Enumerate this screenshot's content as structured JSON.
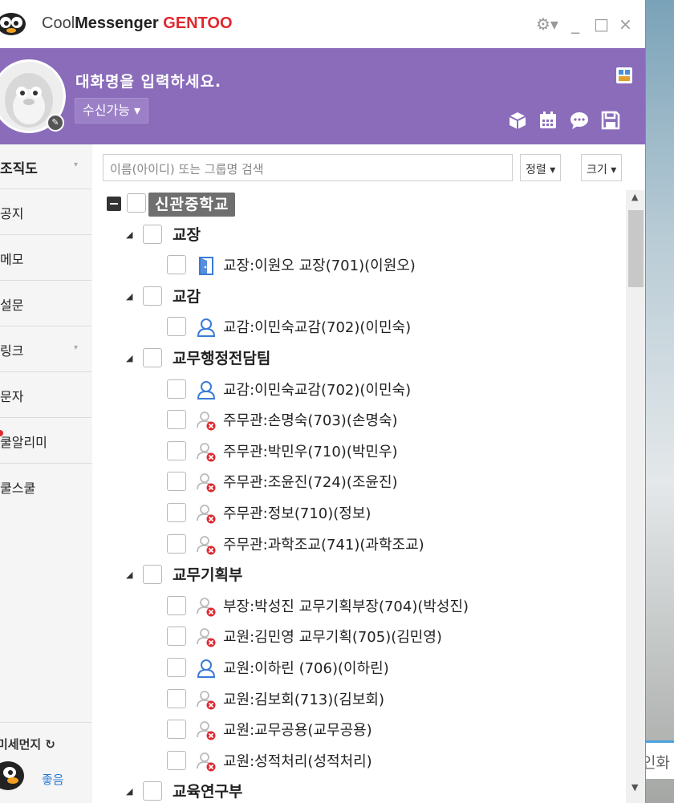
{
  "app": {
    "title_prefix": "Cool",
    "title_main": "Messenger",
    "title_brand": "GENTOO",
    "controls": [
      "⚙▾",
      "_",
      "□",
      "×"
    ]
  },
  "profile": {
    "conversation_placeholder": "대화명을 입력하세요.",
    "status": "수신가능 ▾"
  },
  "nav": {
    "items": [
      {
        "label": "조직도",
        "chevron": "▾"
      },
      {
        "label": "공지"
      },
      {
        "label": "메모"
      },
      {
        "label": "설문"
      },
      {
        "label": "링크",
        "chevron": "▾"
      },
      {
        "label": "문자"
      },
      {
        "label": "쿨알리미"
      },
      {
        "label": "쿨스쿨"
      }
    ],
    "dust_title": "미세먼지 ↻",
    "dust_status": "좋음"
  },
  "search": {
    "placeholder": "이름(아이디) 또는 그룹명 검색",
    "sort_label": "정렬 ▾",
    "size_label": "크기 ▾"
  },
  "tree": {
    "root": "신관중학교",
    "groups": [
      {
        "name": "교장",
        "members": [
          {
            "label": "교장:이원오 교장(701)(이원오)",
            "status": "door"
          }
        ]
      },
      {
        "name": "교감",
        "members": [
          {
            "label": "교감:이민숙교감(702)(이민숙)",
            "status": "online"
          }
        ]
      },
      {
        "name": "교무행정전담팀",
        "members": [
          {
            "label": "교감:이민숙교감(702)(이민숙)",
            "status": "online"
          },
          {
            "label": "주무관:손명숙(703)(손명숙)",
            "status": "offline"
          },
          {
            "label": "주무관:박민우(710)(박민우)",
            "status": "offline"
          },
          {
            "label": "주무관:조윤진(724)(조윤진)",
            "status": "offline"
          },
          {
            "label": "주무관:정보(710)(정보)",
            "status": "offline"
          },
          {
            "label": "주무관:과학조교(741)(과학조교)",
            "status": "offline"
          }
        ]
      },
      {
        "name": "교무기획부",
        "members": [
          {
            "label": "부장:박성진 교무기획부장(704)(박성진)",
            "status": "offline"
          },
          {
            "label": "교원:김민영 교무기획(705)(김민영)",
            "status": "offline"
          },
          {
            "label": "교원:이하린 (706)(이하린)",
            "status": "online"
          },
          {
            "label": "교원:김보회(713)(김보회)",
            "status": "offline"
          },
          {
            "label": "교원:교무공용(교무공용)",
            "status": "offline"
          },
          {
            "label": "교원:성적처리(성적처리)",
            "status": "offline"
          }
        ]
      },
      {
        "name": "교육연구부",
        "members": []
      }
    ]
  },
  "desktop": {
    "caption": "인화"
  },
  "colors": {
    "header_purple": "#8a6cbb",
    "brand_red": "#e0282f",
    "online_blue": "#3a7bd5",
    "offline_red": "#e0282f"
  }
}
